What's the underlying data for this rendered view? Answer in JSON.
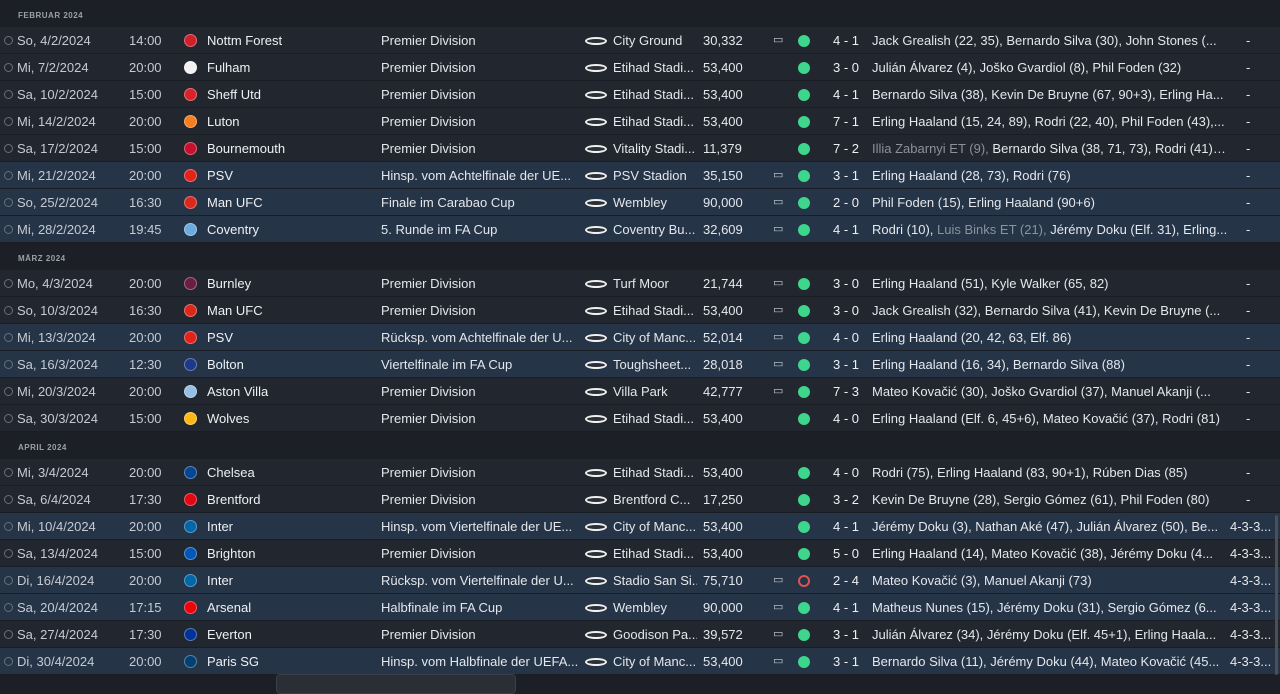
{
  "groups": [
    {
      "month": "FEBRUAR 2024",
      "matches": [
        {
          "date": "So, 4/2/2024",
          "time": "14:00",
          "opponent": "Nottm Forest",
          "logo_color": "#d0202b",
          "competition": "Premier Division",
          "venue": "City Ground",
          "attendance": "30,332",
          "tv": true,
          "result": "win",
          "score": "4 - 1",
          "scorers": "Jack Grealish (22, 35), Bernardo Silva (30), John Stones (...",
          "form": "-",
          "highlight": false
        },
        {
          "date": "Mi, 7/2/2024",
          "time": "20:00",
          "opponent": "Fulham",
          "logo_color": "#f2f2f2",
          "competition": "Premier Division",
          "venue": "Etihad Stadi...",
          "attendance": "53,400",
          "tv": false,
          "result": "win",
          "score": "3 - 0",
          "scorers": "Julián Álvarez (4), Joško Gvardiol (8), Phil Foden (32)",
          "form": "-",
          "highlight": false
        },
        {
          "date": "Sa, 10/2/2024",
          "time": "15:00",
          "opponent": "Sheff Utd",
          "logo_color": "#d8232a",
          "competition": "Premier Division",
          "venue": "Etihad Stadi...",
          "attendance": "53,400",
          "tv": false,
          "result": "win",
          "score": "4 - 1",
          "scorers": "Bernardo Silva (38), Kevin De Bruyne (67, 90+3), Erling Ha...",
          "form": "-",
          "highlight": false
        },
        {
          "date": "Mi, 14/2/2024",
          "time": "20:00",
          "opponent": "Luton",
          "logo_color": "#f57e20",
          "competition": "Premier Division",
          "venue": "Etihad Stadi...",
          "attendance": "53,400",
          "tv": false,
          "result": "win",
          "score": "7 - 1",
          "scorers": "Erling Haaland (15, 24, 89), Rodri (22, 40), Phil Foden (43),...",
          "form": "-",
          "highlight": false
        },
        {
          "date": "Sa, 17/2/2024",
          "time": "15:00",
          "opponent": "Bournemouth",
          "logo_color": "#c8102e",
          "competition": "Premier Division",
          "venue": "Vitality Stadi...",
          "attendance": "11,379",
          "tv": false,
          "result": "win",
          "score": "7 - 2",
          "scorers_muted": "Illia Zabarnyi ET (9), ",
          "scorers": "Bernardo Silva (38, 71, 73), Rodri (41), R...",
          "form": "-",
          "highlight": false
        },
        {
          "date": "Mi, 21/2/2024",
          "time": "20:00",
          "opponent": "PSV",
          "logo_color": "#e2231a",
          "competition": "Hinsp. vom Achtelfinale der UE...",
          "venue": "PSV Stadion",
          "attendance": "35,150",
          "tv": true,
          "result": "win",
          "score": "3 - 1",
          "scorers": "Erling Haaland (28, 73), Rodri (76)",
          "form": "-",
          "highlight": true
        },
        {
          "date": "So, 25/2/2024",
          "time": "16:30",
          "opponent": "Man UFC",
          "logo_color": "#da291c",
          "competition": "Finale im Carabao Cup",
          "venue": "Wembley",
          "attendance": "90,000",
          "tv": true,
          "result": "win",
          "score": "2 - 0",
          "scorers": "Phil Foden (15), Erling Haaland (90+6)",
          "form": "-",
          "highlight": true
        },
        {
          "date": "Mi, 28/2/2024",
          "time": "19:45",
          "opponent": "Coventry",
          "logo_color": "#6cabdd",
          "competition": "5. Runde im FA Cup",
          "venue": "Coventry Bu...",
          "attendance": "32,609",
          "tv": true,
          "result": "win",
          "score": "4 - 1",
          "scorers": "Rodri (10), ",
          "scorers_muted2": "Luis Binks ET (21), ",
          "scorers_tail": "Jérémy Doku (Elf. 31), Erling...",
          "form": "-",
          "highlight": true
        }
      ]
    },
    {
      "month": "MÄRZ 2024",
      "matches": [
        {
          "date": "Mo, 4/3/2024",
          "time": "20:00",
          "opponent": "Burnley",
          "logo_color": "#6c1d45",
          "competition": "Premier Division",
          "venue": "Turf Moor",
          "attendance": "21,744",
          "tv": true,
          "result": "win",
          "score": "3 - 0",
          "scorers": "Erling Haaland (51), Kyle Walker (65, 82)",
          "form": "-",
          "highlight": false
        },
        {
          "date": "So, 10/3/2024",
          "time": "16:30",
          "opponent": "Man UFC",
          "logo_color": "#da291c",
          "competition": "Premier Division",
          "venue": "Etihad Stadi...",
          "attendance": "53,400",
          "tv": true,
          "result": "win",
          "score": "3 - 0",
          "scorers": "Jack Grealish (32), Bernardo Silva (41), Kevin De Bruyne (...",
          "form": "-",
          "highlight": false
        },
        {
          "date": "Mi, 13/3/2024",
          "time": "20:00",
          "opponent": "PSV",
          "logo_color": "#e2231a",
          "competition": "Rücksp. vom Achtelfinale der U...",
          "venue": "City of Manc...",
          "attendance": "52,014",
          "tv": true,
          "result": "win",
          "score": "4 - 0",
          "scorers": "Erling Haaland (20, 42, 63, Elf. 86)",
          "form": "-",
          "highlight": true
        },
        {
          "date": "Sa, 16/3/2024",
          "time": "12:30",
          "opponent": "Bolton",
          "logo_color": "#1b3a8a",
          "competition": "Viertelfinale im FA Cup",
          "venue": "Toughsheet...",
          "attendance": "28,018",
          "tv": true,
          "result": "win",
          "score": "3 - 1",
          "scorers": "Erling Haaland (16, 34), Bernardo Silva (88)",
          "form": "-",
          "highlight": true
        },
        {
          "date": "Mi, 20/3/2024",
          "time": "20:00",
          "opponent": "Aston Villa",
          "logo_color": "#95bfe5",
          "competition": "Premier Division",
          "venue": "Villa Park",
          "attendance": "42,777",
          "tv": true,
          "result": "win",
          "score": "7 - 3",
          "scorers": "Mateo Kovačić (30), Joško Gvardiol (37), Manuel Akanji (...",
          "form": "-",
          "highlight": false
        },
        {
          "date": "Sa, 30/3/2024",
          "time": "15:00",
          "opponent": "Wolves",
          "logo_color": "#fdb913",
          "competition": "Premier Division",
          "venue": "Etihad Stadi...",
          "attendance": "53,400",
          "tv": false,
          "result": "win",
          "score": "4 - 0",
          "scorers": "Erling Haaland (Elf. 6, 45+6), Mateo Kovačić (37), Rodri (81)",
          "form": "-",
          "highlight": false
        }
      ]
    },
    {
      "month": "APRIL 2024",
      "matches": [
        {
          "date": "Mi, 3/4/2024",
          "time": "20:00",
          "opponent": "Chelsea",
          "logo_color": "#034694",
          "competition": "Premier Division",
          "venue": "Etihad Stadi...",
          "attendance": "53,400",
          "tv": false,
          "result": "win",
          "score": "4 - 0",
          "scorers": "Rodri (75), Erling Haaland (83, 90+1), Rúben Dias (85)",
          "form": "-",
          "highlight": false
        },
        {
          "date": "Sa, 6/4/2024",
          "time": "17:30",
          "opponent": "Brentford",
          "logo_color": "#e30613",
          "competition": "Premier Division",
          "venue": "Brentford C...",
          "attendance": "17,250",
          "tv": false,
          "result": "win",
          "score": "3 - 2",
          "scorers": "Kevin De Bruyne (28), Sergio Gómez (61), Phil Foden (80)",
          "form": "-",
          "highlight": false
        },
        {
          "date": "Mi, 10/4/2024",
          "time": "20:00",
          "opponent": "Inter",
          "logo_color": "#0068a8",
          "competition": "Hinsp. vom Viertelfinale der UE...",
          "venue": "City of Manc...",
          "attendance": "53,400",
          "tv": false,
          "result": "win",
          "score": "4 - 1",
          "scorers": "Jérémy Doku (3), Nathan Aké (47), Julián Álvarez (50), Be...",
          "form": "4-3-3...",
          "highlight": true
        },
        {
          "date": "Sa, 13/4/2024",
          "time": "15:00",
          "opponent": "Brighton",
          "logo_color": "#0057b8",
          "competition": "Premier Division",
          "venue": "Etihad Stadi...",
          "attendance": "53,400",
          "tv": false,
          "result": "win",
          "score": "5 - 0",
          "scorers": "Erling Haaland (14), Mateo Kovačić (38), Jérémy Doku (4...",
          "form": "4-3-3...",
          "highlight": false
        },
        {
          "date": "Di, 16/4/2024",
          "time": "20:00",
          "opponent": "Inter",
          "logo_color": "#0068a8",
          "competition": "Rücksp. vom Viertelfinale der U...",
          "venue": "Stadio San Si...",
          "attendance": "75,710",
          "tv": true,
          "result": "loss",
          "score": "2 - 4",
          "scorers": "Mateo Kovačić (3), Manuel Akanji (73)",
          "form": "4-3-3...",
          "highlight": true
        },
        {
          "date": "Sa, 20/4/2024",
          "time": "17:15",
          "opponent": "Arsenal",
          "logo_color": "#ef0107",
          "competition": "Halbfinale im FA Cup",
          "venue": "Wembley",
          "attendance": "90,000",
          "tv": true,
          "result": "win",
          "score": "4 - 1",
          "scorers": "Matheus Nunes (15), Jérémy Doku (31), Sergio Gómez (6...",
          "form": "4-3-3...",
          "highlight": true
        },
        {
          "date": "Sa, 27/4/2024",
          "time": "17:30",
          "opponent": "Everton",
          "logo_color": "#003399",
          "competition": "Premier Division",
          "venue": "Goodison Pa...",
          "attendance": "39,572",
          "tv": true,
          "result": "win",
          "score": "3 - 1",
          "scorers": "Julián Álvarez (34), Jérémy Doku (Elf. 45+1), Erling Haala...",
          "form": "4-3-3...",
          "highlight": false
        },
        {
          "date": "Di, 30/4/2024",
          "time": "20:00",
          "opponent": "Paris SG",
          "logo_color": "#004170",
          "competition": "Hinsp. vom Halbfinale der UEFA...",
          "venue": "City of Manc...",
          "attendance": "53,400",
          "tv": true,
          "result": "win",
          "score": "3 - 1",
          "scorers": "Bernardo Silva (11), Jérémy Doku (44), Mateo Kovačić (45...",
          "form": "4-3-3...",
          "highlight": true
        }
      ]
    }
  ]
}
